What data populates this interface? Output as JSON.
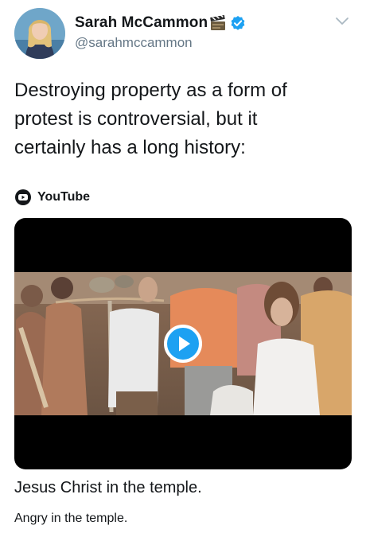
{
  "author": {
    "display_name": "Sarah McCammon",
    "handle": "@sarahmccammon",
    "badges": [
      "clapperboard-emoji",
      "verified-badge"
    ],
    "verified_color": "#1da1f2"
  },
  "tweet": {
    "text": "Destroying property as a form of\nprotest is controversial, but it\ncertainly has a long history:"
  },
  "link_card": {
    "source": "YouTube",
    "source_icon": "youtube-icon",
    "title": "Jesus Christ in the temple.",
    "description": "Angry in the temple.",
    "play_icon": "play-icon",
    "play_color": "#1da1f2"
  },
  "controls": {
    "menu_icon": "chevron-down-icon"
  }
}
